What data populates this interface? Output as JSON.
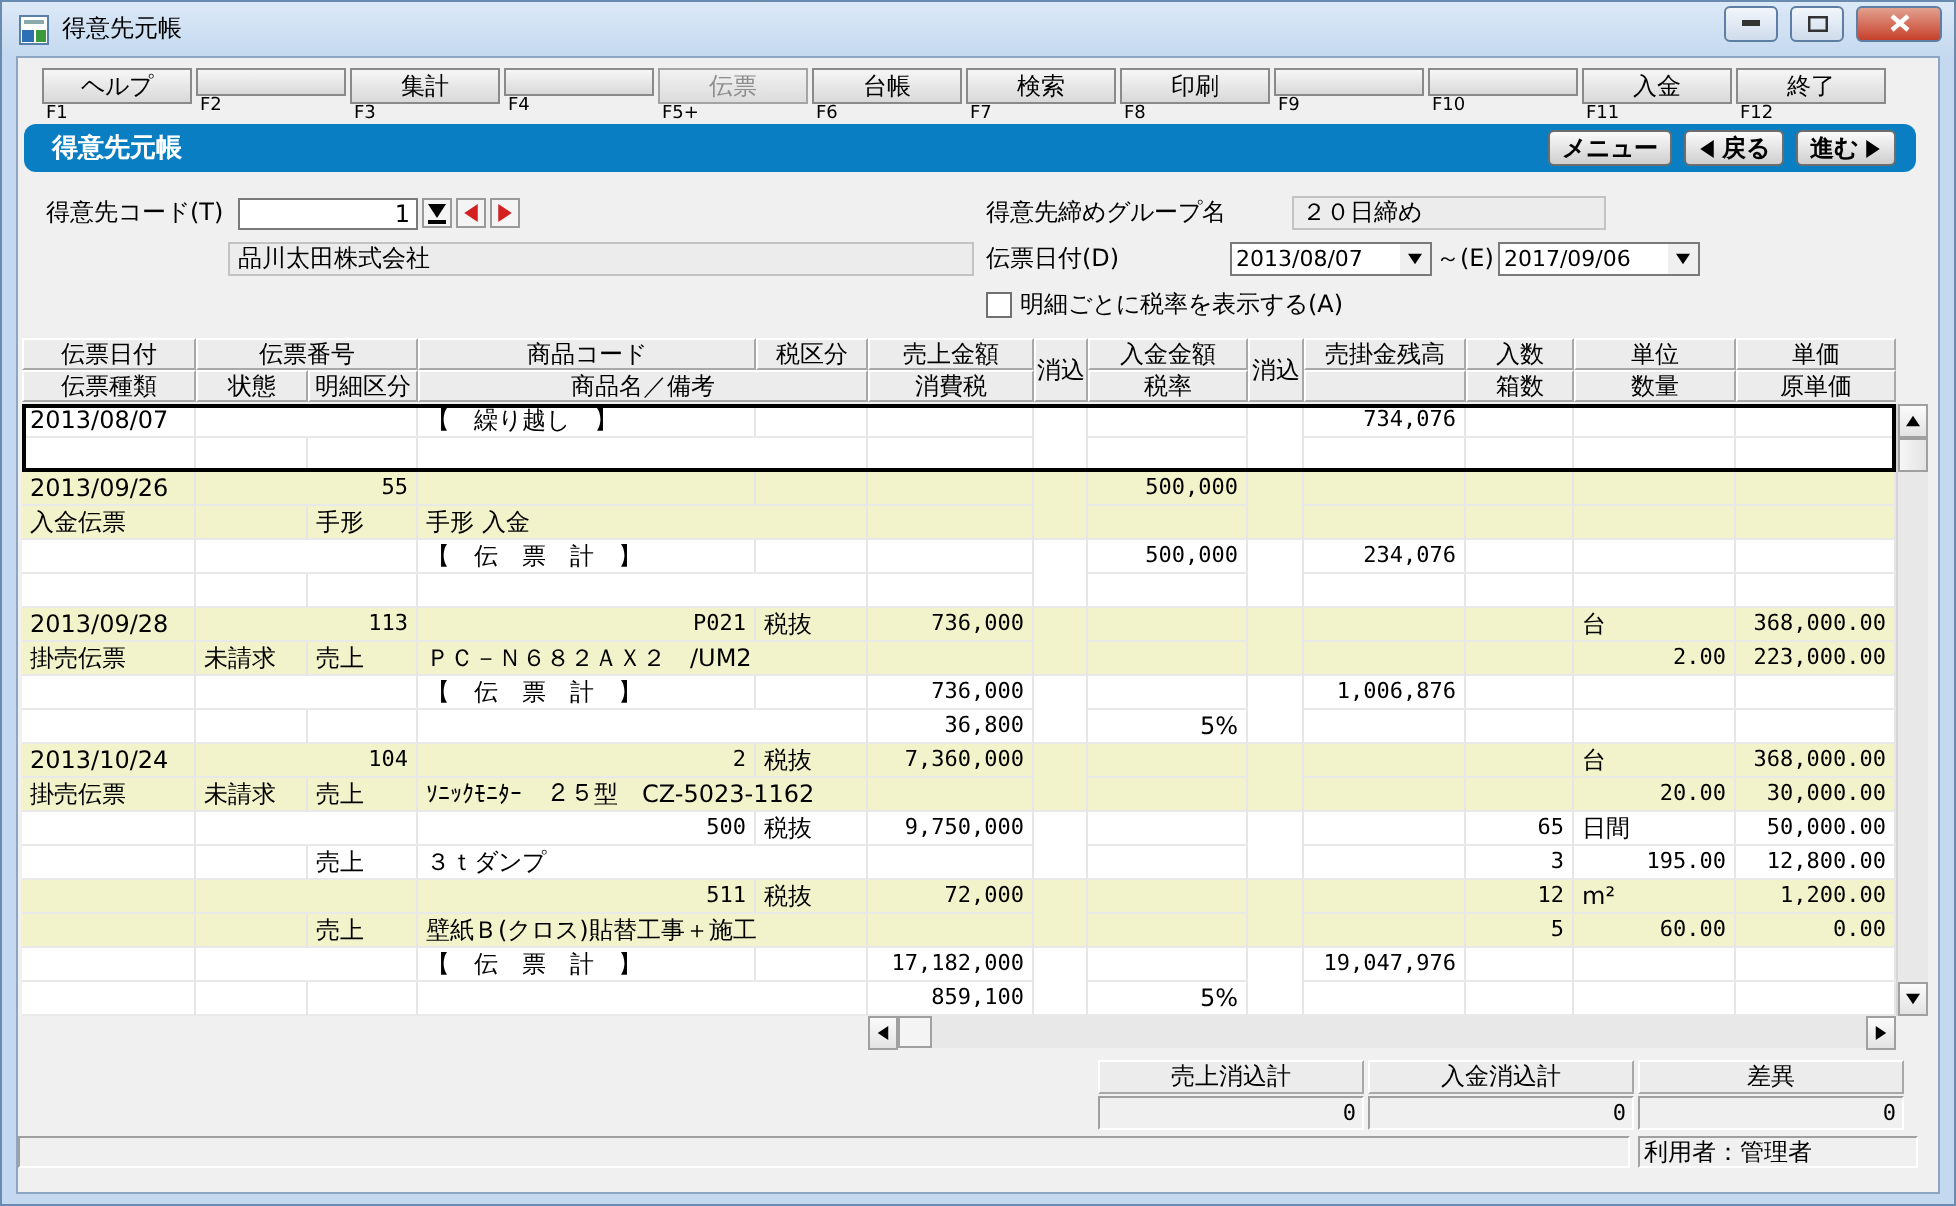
{
  "window": {
    "title": "得意先元帳"
  },
  "function_keys": [
    {
      "key": "F1",
      "label": "ヘルプ",
      "disabled": false
    },
    {
      "key": "F2",
      "disabled": false
    },
    {
      "key": "F3",
      "label": "集計",
      "disabled": false
    },
    {
      "key": "F4",
      "disabled": false
    },
    {
      "key": "F5+",
      "label": "伝票",
      "disabled": true
    },
    {
      "key": "F6",
      "label": "台帳",
      "disabled": false
    },
    {
      "key": "F7",
      "label": "検索",
      "disabled": false
    },
    {
      "key": "F8",
      "label": "印刷",
      "disabled": false
    },
    {
      "key": "F9",
      "disabled": false
    },
    {
      "key": "F10",
      "disabled": false
    },
    {
      "key": "F11",
      "label": "入金",
      "disabled": false
    },
    {
      "key": "F12",
      "label": "終了",
      "disabled": false
    }
  ],
  "header": {
    "title": "得意先元帳",
    "buttons": [
      {
        "label": "メニュー",
        "kind": "menu"
      },
      {
        "label": "戻る",
        "kind": "back"
      },
      {
        "label": "進む",
        "kind": "forward"
      }
    ]
  },
  "form": {
    "customer_code": {
      "label": "得意先コード(T)",
      "value": "1"
    },
    "customer_name": "品川太田株式会社",
    "group": {
      "label": "得意先締めグループ名",
      "value": "２０日締め"
    },
    "date": {
      "label": "伝票日付(D)",
      "from": "2013/08/07",
      "separator": "～(E)",
      "to": "2017/09/06"
    },
    "show_tax_rate": {
      "label": "明細ごとに税率を表示する(A)",
      "checked": false
    }
  },
  "table": {
    "columns_top": [
      "伝票日付",
      "伝票番号",
      "商品コード",
      "税区分",
      "売上金額",
      "消込",
      "入金金額",
      "消込",
      "売掛金残高",
      "入数",
      "単位",
      "単価"
    ],
    "columns_bottom": [
      "伝票種類",
      "状態",
      "明細区分",
      "商品名／備考",
      "消費税",
      "税率",
      "箱数",
      "数量",
      "原単価"
    ],
    "records": [
      {
        "selected": true,
        "shaded": false,
        "line1": {
          "date": "2013/08/07",
          "label": "【　繰り越し　】",
          "balance": "734,076"
        }
      },
      {
        "selected": false,
        "shaded": true,
        "line1": {
          "date": "2013/09/26",
          "number": "55",
          "payment": "500,000"
        },
        "line2": {
          "type": "入金伝票",
          "detail": "手形",
          "name": "手形 入金"
        }
      },
      {
        "selected": false,
        "shaded": false,
        "line1": {
          "label": "【　伝　票　計　】",
          "payment": "500,000",
          "balance": "234,076"
        }
      },
      {
        "selected": false,
        "shaded": true,
        "line1": {
          "date": "2013/09/28",
          "number": "113",
          "code": "P021",
          "tax_class": "税抜",
          "sales": "736,000",
          "unit": "台",
          "price": "368,000.00"
        },
        "line2": {
          "type": "掛売伝票",
          "status": "未請求",
          "detail": "売上",
          "name": "ＰＣ－Ｎ６８２ＡＸ２　/UM2",
          "quantity": "2.00",
          "cost": "223,000.00"
        }
      },
      {
        "selected": false,
        "shaded": false,
        "line1": {
          "label": "【　伝　票　計　】",
          "sales": "736,000",
          "balance": "1,006,876"
        },
        "line2": {
          "tax": "36,800",
          "rate": "5%"
        }
      },
      {
        "selected": false,
        "shaded": true,
        "line1": {
          "date": "2013/10/24",
          "number": "104",
          "code": "2",
          "tax_class": "税抜",
          "sales": "7,360,000",
          "unit": "台",
          "price": "368,000.00"
        },
        "line2": {
          "type": "掛売伝票",
          "status": "未請求",
          "detail": "売上",
          "name": "ｿﾆｯｸﾓﾆﾀｰ　２５型　CZ-5023-1162",
          "quantity": "20.00",
          "cost": "30,000.00"
        }
      },
      {
        "selected": false,
        "shaded": false,
        "line1": {
          "code": "500",
          "tax_class": "税抜",
          "sales": "9,750,000",
          "count": "65",
          "unit": "日間",
          "price": "50,000.00"
        },
        "line2": {
          "detail": "売上",
          "name": "３ｔダンプ",
          "boxes": "3",
          "quantity": "195.00",
          "cost": "12,800.00"
        }
      },
      {
        "selected": false,
        "shaded": true,
        "line1": {
          "code": "511",
          "tax_class": "税抜",
          "sales": "72,000",
          "count": "12",
          "unit": "m²",
          "price": "1,200.00"
        },
        "line2": {
          "detail": "売上",
          "name": "壁紙Ｂ(クロス)貼替工事＋施工",
          "boxes": "5",
          "quantity": "60.00",
          "cost": "0.00"
        }
      },
      {
        "selected": false,
        "shaded": false,
        "line1": {
          "label": "【　伝　票　計　】",
          "sales": "17,182,000",
          "balance": "19,047,976"
        },
        "line2": {
          "tax": "859,100",
          "rate": "5%"
        }
      }
    ]
  },
  "summary": [
    {
      "label": "売上消込計",
      "value": "0"
    },
    {
      "label": "入金消込計",
      "value": "0"
    },
    {
      "label": "差異",
      "value": "0"
    }
  ],
  "status_bar": {
    "user": "利用者：管理者"
  }
}
